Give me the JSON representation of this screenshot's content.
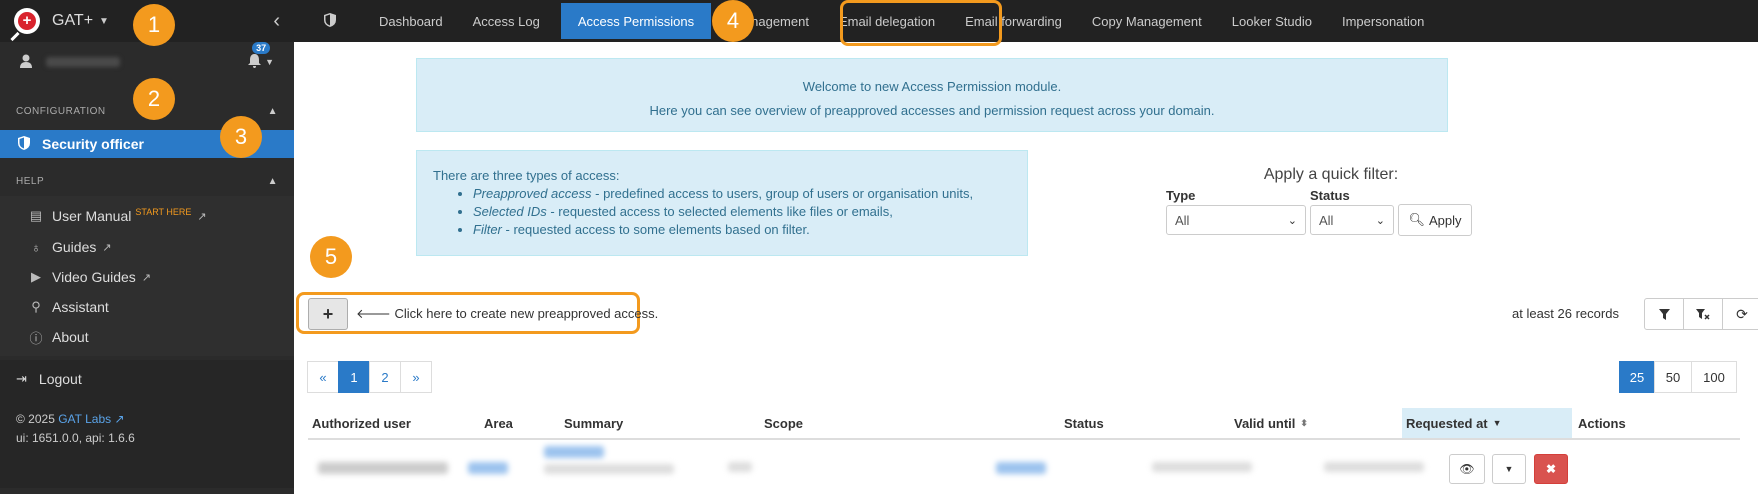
{
  "app": {
    "name": "GAT+"
  },
  "user": {
    "notification_count": "37"
  },
  "sidebar": {
    "config_section": "CONFIGURATION",
    "active_item": "Security officer",
    "help_section": "HELP",
    "help_items": [
      {
        "label": "User Manual",
        "icon": "book-icon",
        "badge": "START HERE"
      },
      {
        "label": "Guides",
        "icon": "lightbulb-icon"
      },
      {
        "label": "Video Guides",
        "icon": "play-icon"
      },
      {
        "label": "Assistant",
        "icon": "user-search-icon"
      },
      {
        "label": "About",
        "icon": "info-icon"
      }
    ],
    "logout": "Logout",
    "footer": {
      "copyright": "© 2025",
      "company_link": "GAT Labs",
      "version": "ui: 1651.0.0, api: 1.6.6"
    }
  },
  "topnav": {
    "items": [
      "Dashboard",
      "Access Log",
      "Access Permissions",
      "nagement",
      "Email delegation",
      "Email forwarding",
      "Copy Management",
      "Looker Studio",
      "Impersonation"
    ],
    "active": "Access Permissions"
  },
  "welcome": {
    "line1": "Welcome to new Access Permission module.",
    "line2": "Here you can see overview of preapproved accesses and permission request across your domain."
  },
  "types_info": {
    "intro": "There are three types of access:",
    "items": [
      {
        "name": "Preapproved access",
        "desc": " - predefined access to users, group of users or organisation units,"
      },
      {
        "name": "Selected IDs",
        "desc": " - requested access to selected elements like files or emails,"
      },
      {
        "name": "Filter",
        "desc": " - requested access to some elements based on filter."
      }
    ]
  },
  "quick_filter": {
    "title": "Apply a quick filter:",
    "type_label": "Type",
    "type_value": "All",
    "status_label": "Status",
    "status_value": "All",
    "apply_label": "Apply"
  },
  "create": {
    "button": "+",
    "hint": "Click here to create new preapproved access."
  },
  "records": "at least 26 records",
  "pagination": {
    "prev": "«",
    "pages": [
      "1",
      "2"
    ],
    "next": "»",
    "current": "1"
  },
  "page_sizes": [
    "25",
    "50",
    "100"
  ],
  "table": {
    "columns": [
      "Authorized user",
      "Area",
      "Summary",
      "Scope",
      "Status",
      "Valid until",
      "Requested at",
      "Actions"
    ]
  },
  "callouts": [
    "1",
    "2",
    "3",
    "4",
    "5"
  ],
  "colors": {
    "accent": "#2a7ac8",
    "callout": "#f39a1e",
    "sidebar": "#2b2b2b",
    "info_bg": "#d9edf7",
    "danger": "#d9534f"
  }
}
